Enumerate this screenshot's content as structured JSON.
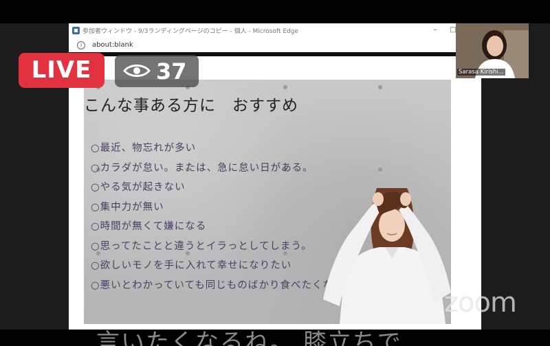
{
  "browser": {
    "window_title": "参加者ウィンドウ - 9/3ランディングページのコピー - 個人 - Microsoft Edge",
    "url": "about:blank"
  },
  "slide": {
    "heading": "こんな事ある方に　おすすめ",
    "items": [
      "○最近、物忘れが多い",
      "○カラダが怠い。または、急に怠い日がある。",
      "○やる気が起きない",
      "○集中力が無い",
      "○時間が無くて嫌になる",
      "○思ってたことと違うとイラっとしてしまう。",
      "○欲しいモノを手に入れて幸せになりたい",
      "○悪いとわかっていても同じものばかり食べたくなる。"
    ]
  },
  "live_badge": {
    "label": "LIVE",
    "color": "#e2323f"
  },
  "viewers": {
    "count": "37",
    "icon": "eye-icon"
  },
  "participant": {
    "name": "Sarasa Kirishi..."
  },
  "watermark": {
    "logo": "zoom"
  },
  "caption": {
    "text": "言いたくなるね。 膝立ちで"
  }
}
